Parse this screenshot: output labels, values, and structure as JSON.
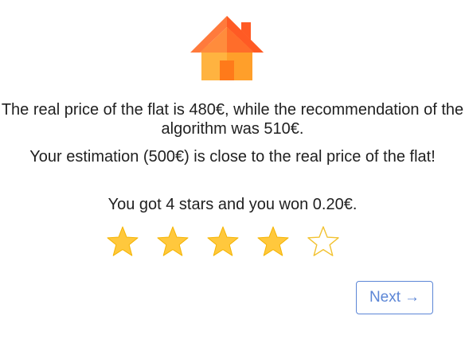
{
  "result": {
    "paragraph1": "The real price of the flat is 480€, while the recommendation of the algorithm was 510€.",
    "paragraph2": "Your estimation (500€) is close to the real price of the flat!",
    "paragraph3": "You got 4 stars and you won 0.20€."
  },
  "rating": {
    "filled": 4,
    "total": 5,
    "filled_color": "#ffc83d",
    "empty_color": "#f2c230"
  },
  "house_icon": {
    "name": "house-icon",
    "roof_color": "#ff6d33",
    "wall_color": "#ffb340",
    "door_color": "#ff8c1a"
  },
  "next_button": {
    "label": "Next",
    "icon": "arrow-right-icon",
    "arrow": "→",
    "color": "#5c86d6"
  }
}
